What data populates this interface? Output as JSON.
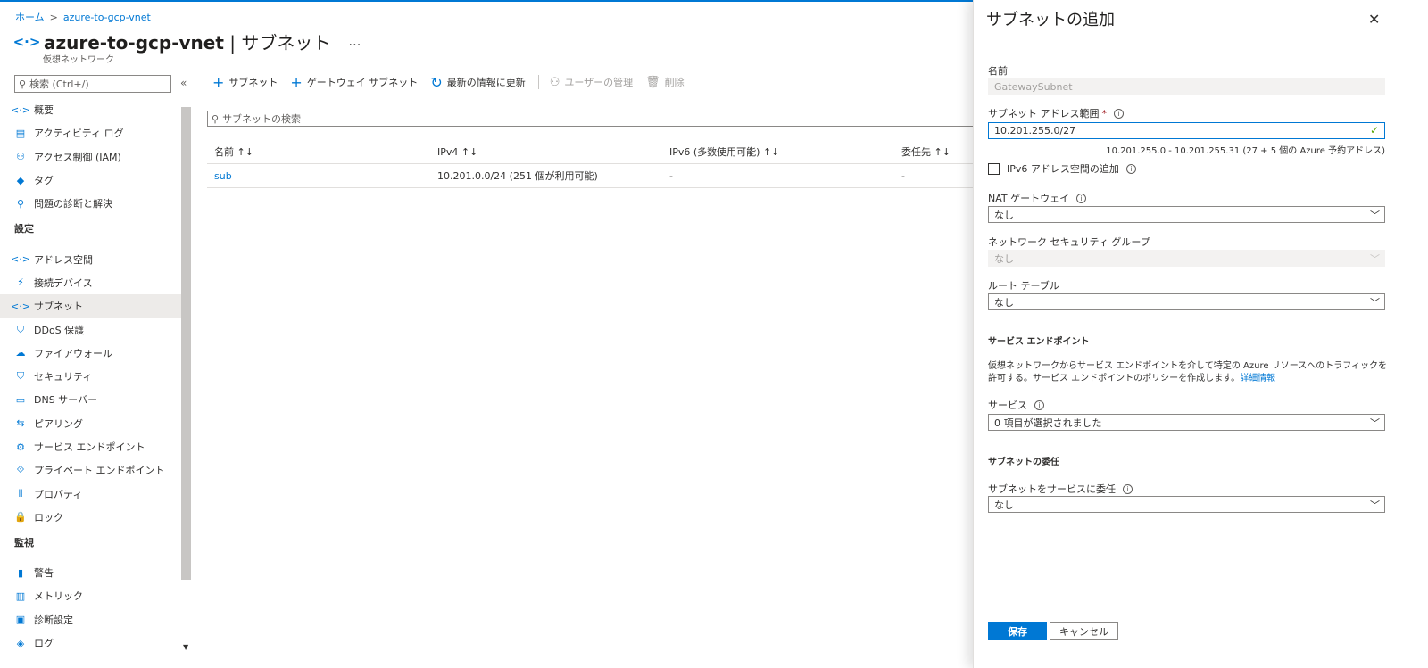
{
  "breadcrumb": {
    "home": "ホーム",
    "current": "azure-to-gcp-vnet"
  },
  "header": {
    "resource": "azure-to-gcp-vnet",
    "separator": " | ",
    "page": "サブネット",
    "more": "…",
    "subtitle": "仮想ネットワーク"
  },
  "sidebar": {
    "search_placeholder": "検索 (Ctrl+/)",
    "collapse": "«",
    "items_top": [
      {
        "label": "概要",
        "icon": "<·>"
      },
      {
        "label": "アクティビティ ログ",
        "icon": "▤"
      },
      {
        "label": "アクセス制御 (IAM)",
        "icon": "⚇"
      },
      {
        "label": "タグ",
        "icon": "◆"
      },
      {
        "label": "問題の診断と解決",
        "icon": "⚲"
      }
    ],
    "section_settings": "設定",
    "items_settings": [
      {
        "label": "アドレス空間",
        "icon": "<·>"
      },
      {
        "label": "接続デバイス",
        "icon": "⚡"
      },
      {
        "label": "サブネット",
        "icon": "<·>"
      },
      {
        "label": "DDoS 保護",
        "icon": "⛉"
      },
      {
        "label": "ファイアウォール",
        "icon": "☁"
      },
      {
        "label": "セキュリティ",
        "icon": "⛉"
      },
      {
        "label": "DNS サーバー",
        "icon": "▭"
      },
      {
        "label": "ピアリング",
        "icon": "⇆"
      },
      {
        "label": "サービス エンドポイント",
        "icon": "⚙"
      },
      {
        "label": "プライベート エンドポイント",
        "icon": "⟐"
      },
      {
        "label": "プロパティ",
        "icon": "⫴"
      },
      {
        "label": "ロック",
        "icon": "🔒"
      }
    ],
    "section_monitor": "監視",
    "items_monitor": [
      {
        "label": "警告",
        "icon": "▮"
      },
      {
        "label": "メトリック",
        "icon": "▥"
      },
      {
        "label": "診断設定",
        "icon": "▣"
      },
      {
        "label": "ログ",
        "icon": "◈"
      }
    ]
  },
  "toolbar": {
    "add_subnet": "サブネット",
    "add_gateway_subnet": "ゲートウェイ サブネット",
    "refresh": "最新の情報に更新",
    "manage_users": "ユーザーの管理",
    "delete": "削除"
  },
  "main": {
    "search_placeholder": "サブネットの検索",
    "columns": [
      "名前 ↑↓",
      "IPv4 ↑↓",
      "IPv6 (多数使用可能) ↑↓",
      "委任先 ↑↓"
    ],
    "rows": [
      {
        "name": "sub",
        "ipv4": "10.201.0.0/24 (251 個が利用可能)",
        "ipv6": "-",
        "delegate": "-"
      }
    ]
  },
  "panel": {
    "title": "サブネットの追加",
    "close": "✕",
    "name_label": "名前",
    "name_value": "GatewaySubnet",
    "range_label": "サブネット アドレス範囲",
    "range_required": "*",
    "range_value": "10.201.255.0/27",
    "range_hint": "10.201.255.0 - 10.201.255.31 (27 + 5 個の Azure 予約アドレス)",
    "ipv6_label": "IPv6 アドレス空間の追加",
    "nat_label": "NAT ゲートウェイ",
    "nat_value": "なし",
    "nsg_label": "ネットワーク セキュリティ グループ",
    "nsg_value": "なし",
    "route_label": "ルート テーブル",
    "route_value": "なし",
    "svc_endpoint_title": "サービス エンドポイント",
    "svc_desc": "仮想ネットワークからサービス エンドポイントを介して特定の Azure リソースへのトラフィックを許可する。サービス エンドポイントのポリシーを作成します。",
    "svc_desc_link": "詳細情報",
    "services_label": "サービス",
    "services_value": "0 項目が選択されました",
    "delegation_title": "サブネットの委任",
    "delegate_label": "サブネットをサービスに委任",
    "delegate_value": "なし",
    "save": "保存",
    "cancel": "キャンセル"
  },
  "colors": {
    "accent": "#0078d4",
    "valid": "#57a300"
  }
}
